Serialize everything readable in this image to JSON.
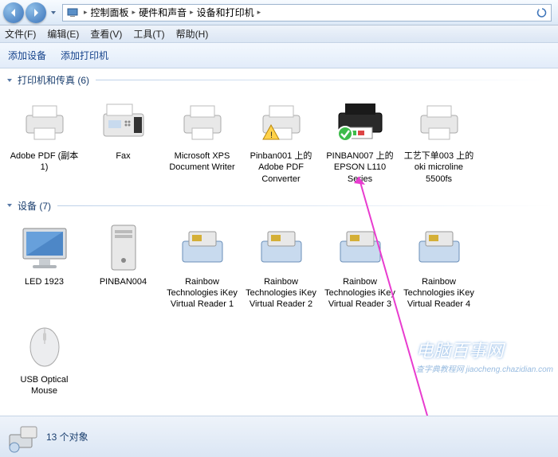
{
  "breadcrumb": {
    "root": "",
    "p1": "控制面板",
    "p2": "硬件和声音",
    "p3": "设备和打印机"
  },
  "menu": {
    "file": "文件(F)",
    "edit": "编辑(E)",
    "view": "查看(V)",
    "tools": "工具(T)",
    "help": "帮助(H)"
  },
  "toolbar": {
    "add_device": "添加设备",
    "add_printer": "添加打印机"
  },
  "sections": {
    "printers": {
      "title": "打印机和传真 (6)"
    },
    "devices": {
      "title": "设备 (7)"
    }
  },
  "printers": [
    {
      "name": "Adobe PDF (副本 1)"
    },
    {
      "name": "Fax"
    },
    {
      "name": "Microsoft XPS Document Writer"
    },
    {
      "name": "Pinban001 上的 Adobe PDF Converter"
    },
    {
      "name": "PINBAN007 上的 EPSON L110 Series"
    },
    {
      "name": "工艺下单003 上的 oki microline 5500fs"
    }
  ],
  "devices": [
    {
      "name": "LED 1923"
    },
    {
      "name": "PINBAN004"
    },
    {
      "name": "Rainbow Technologies iKey Virtual Reader 1"
    },
    {
      "name": "Rainbow Technologies iKey Virtual Reader 2"
    },
    {
      "name": "Rainbow Technologies iKey Virtual Reader 3"
    },
    {
      "name": "Rainbow Technologies iKey Virtual Reader 4"
    },
    {
      "name": "USB Optical Mouse"
    }
  ],
  "status": {
    "count_text": "13 个对象"
  },
  "watermark": {
    "main": "电脑百事网",
    "sub": "查字典教程网 jiaocheng.chazidian.com"
  }
}
